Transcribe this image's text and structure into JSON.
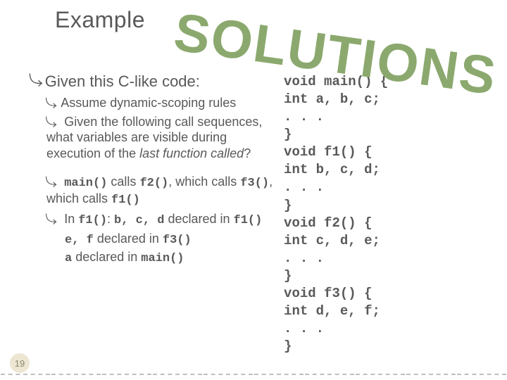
{
  "slide": {
    "title": "Example",
    "stamp": "SOLUTIONS",
    "page_number": "19"
  },
  "content": {
    "b1": "Given this C-like code:",
    "b2a": "Assume dynamic-scoping rules",
    "b2b": "Given the following call sequences, what variables are visible during execution of the ",
    "b2b_em": "last function called",
    "b2b_tail": "?",
    "b2c_pre": "main()",
    "b2c_mid1": " calls ",
    "b2c_f2": "f2()",
    "b2c_mid2": ", which calls ",
    "b2c_f3": "f3()",
    "b2c_mid3": ", which calls ",
    "b2c_f1": "f1()",
    "b2d_pre": "In ",
    "b2d_f1": "f1()",
    "b2d_mid": ": ",
    "b2d_vars": "b, c, d",
    "b2d_tail": " declared in ",
    "b2d_fn": "f1()",
    "b3a_vars": "e, f",
    "b3a_mid": " declared in ",
    "b3a_fn": "f3()",
    "b3b_vars": "a",
    "b3b_mid": " declared in ",
    "b3b_fn": "main()"
  },
  "code": {
    "l1": "void main() {",
    "l2": "  int a, b, c;",
    "l3": "  . . .",
    "l4": "}",
    "l5": "void f1() {",
    "l6": "  int b, c, d;",
    "l7": "  . . .",
    "l8": "}",
    "l9": "void f2() {",
    "l10": "  int c, d, e;",
    "l11": "  . . .",
    "l12": "}",
    "l13": "void f3() {",
    "l14": "  int d, e, f;",
    "l15": "  . . .",
    "l16": "}"
  }
}
